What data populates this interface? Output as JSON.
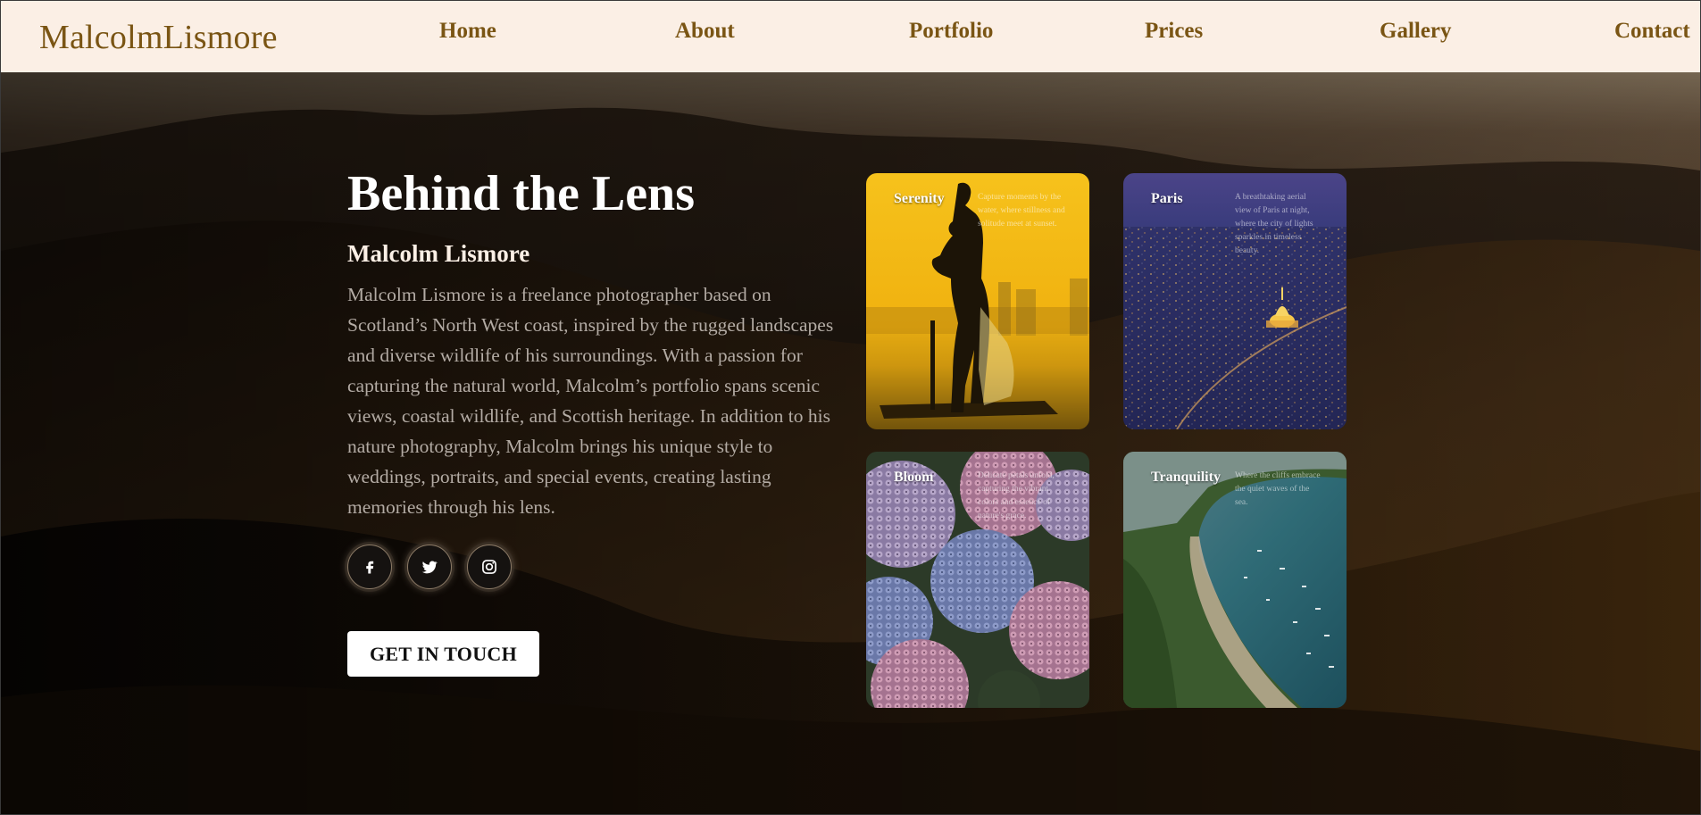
{
  "header": {
    "logo": "MalcolmLismore",
    "nav": [
      "Home",
      "About",
      "Portfolio",
      "Prices",
      "Gallery",
      "Contact"
    ]
  },
  "hero": {
    "title": "Behind the Lens",
    "subtitle": "Malcolm Lismore",
    "bio": "Malcolm Lismore is a freelance photographer based on Scotland’s North West coast, inspired by the rugged landscapes and diverse wildlife of his surroundings. With a passion for capturing the natural world, Malcolm’s portfolio spans scenic views, coastal wildlife, and Scottish heritage. In addition to his nature photography, Malcolm brings his unique style to weddings, portraits, and special events, creating lasting memories through his lens.",
    "cta_label": "GET IN TOUCH",
    "social": [
      "facebook-icon",
      "twitter-icon",
      "instagram-icon"
    ]
  },
  "cards": [
    {
      "title": "Serenity",
      "description": "Capture moments by the water, where stillness and solitude meet at sunset."
    },
    {
      "title": "Paris",
      "description": "A breathtaking aerial view of Paris at night, where the city of lights sparkles in timeless beauty."
    },
    {
      "title": "Bloom",
      "description": "Delicate petals unfold, capturing the vibrant colors and essence of nature's grace."
    },
    {
      "title": "Tranquility",
      "description": "Where the cliffs embrace the quiet waves of the sea."
    }
  ],
  "colors": {
    "header_bg": "#fbefe5",
    "brand_brown": "#7a5514",
    "title_white": "#ffffff",
    "bio_gray": "#b3aba4"
  }
}
